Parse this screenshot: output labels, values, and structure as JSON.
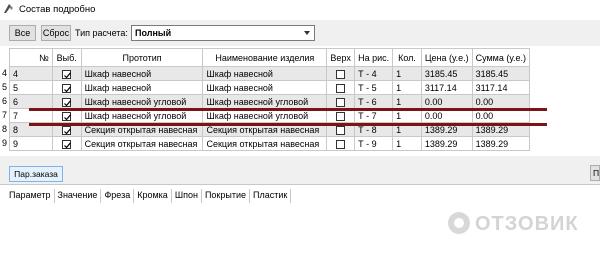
{
  "window": {
    "title": "Состав подробно"
  },
  "toolbar": {
    "all_label": "Все",
    "reset_label": "Сброс",
    "calc_type_label": "Тип расчета:",
    "calc_type_value": "Полный"
  },
  "grid": {
    "columns": [
      "№",
      "Выб.",
      "Прототип",
      "Наименование изделия",
      "Верх",
      "На рис.",
      "Кол.",
      "Цена (у.е.)",
      "Сумма (у.е.)"
    ],
    "rows": [
      {
        "gutter": "4",
        "num": "4",
        "selected": true,
        "prototype": "Шкаф навесной",
        "name": "Шкаф навесной",
        "top": false,
        "fig": "Т - 4",
        "qty": "1",
        "price": "3185.45",
        "sum": "3185.45"
      },
      {
        "gutter": "5",
        "num": "5",
        "selected": true,
        "prototype": "Шкаф навесной",
        "name": "Шкаф навесной",
        "top": false,
        "fig": "Т - 5",
        "qty": "1",
        "price": "3117.14",
        "sum": "3117.14"
      },
      {
        "gutter": "6",
        "num": "6",
        "selected": true,
        "prototype": "Шкаф навесной угловой",
        "name": "Шкаф навесной угловой",
        "top": false,
        "fig": "Т - 6",
        "qty": "1",
        "price": "0.00",
        "sum": "0.00"
      },
      {
        "gutter": "7",
        "num": "7",
        "selected": true,
        "prototype": "Шкаф навесной угловой",
        "name": "Шкаф навесной угловой",
        "top": false,
        "fig": "Т - 7",
        "qty": "1",
        "price": "0.00",
        "sum": "0.00"
      },
      {
        "gutter": "8",
        "num": "8",
        "selected": true,
        "prototype": "Секция открытая навесная",
        "name": "Секция открытая навесная",
        "top": false,
        "fig": "Т - 8",
        "qty": "1",
        "price": "1389.29",
        "sum": "1389.29"
      },
      {
        "gutter": "9",
        "num": "9",
        "selected": true,
        "prototype": "Секция открытая навесная",
        "name": "Секция открытая навесная",
        "top": false,
        "fig": "Т - 9",
        "qty": "1",
        "price": "1389.29",
        "sum": "1389.29"
      }
    ]
  },
  "tabs": {
    "order_params": "Пар.заказа",
    "right_edge": "П"
  },
  "params_grid": {
    "columns": [
      "Параметр",
      "Значение",
      "Фреза",
      "Кромка",
      "Шпон",
      "Покрытие",
      "Пластик"
    ]
  },
  "watermark": {
    "text": "ОТЗОВИК"
  },
  "colors": {
    "highlight_line": "#7a1418",
    "alt_row": "#e8e8e8",
    "tab_active": "#e5f1fb"
  }
}
